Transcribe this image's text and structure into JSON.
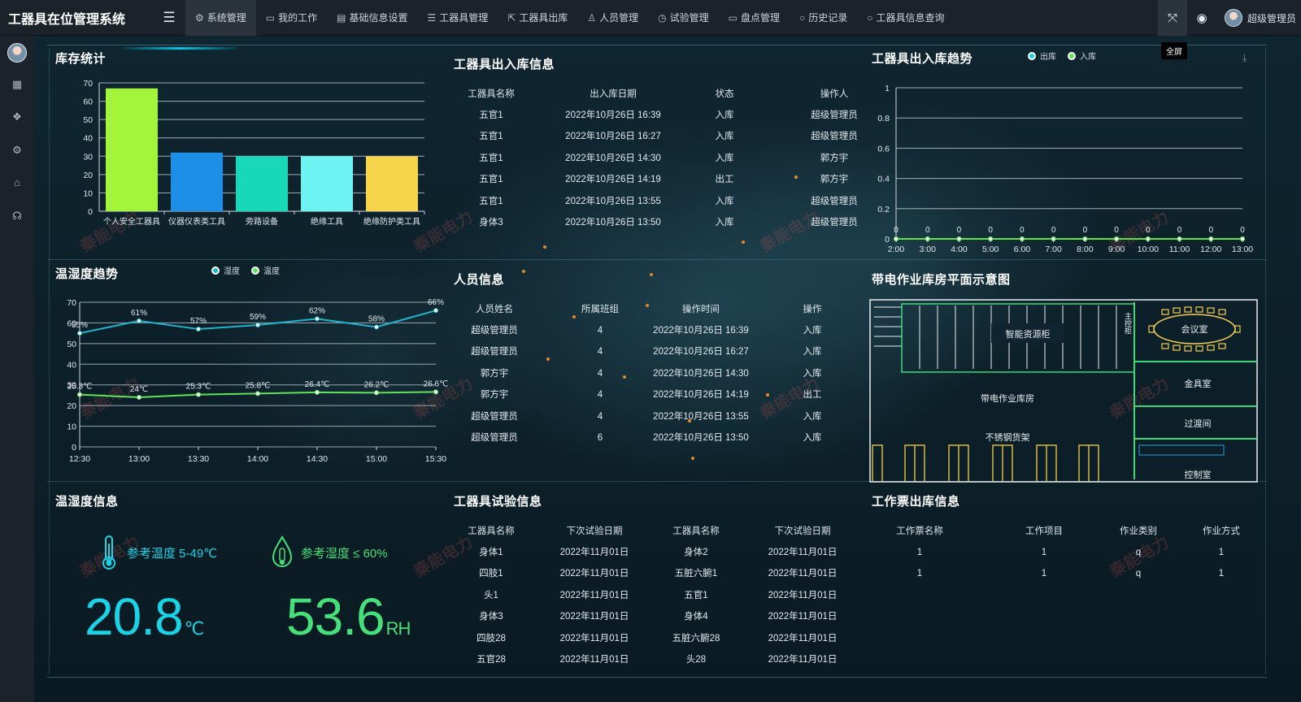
{
  "app_title": "工器具在位管理系统",
  "nav": [
    {
      "label": "系统管理",
      "icon": "gear-icon",
      "active": true
    },
    {
      "label": "我的工作",
      "icon": "monitor-icon"
    },
    {
      "label": "基础信息设置",
      "icon": "document-icon"
    },
    {
      "label": "工器具管理",
      "icon": "list-icon"
    },
    {
      "label": "工器具出库",
      "icon": "export-icon"
    },
    {
      "label": "人员管理",
      "icon": "users-icon"
    },
    {
      "label": "试验管理",
      "icon": "clock-icon"
    },
    {
      "label": "盘点管理",
      "icon": "monitor-icon"
    },
    {
      "label": "历史记录",
      "icon": "circle-icon"
    },
    {
      "label": "工器具信息查询",
      "icon": "circle-icon"
    }
  ],
  "topright": {
    "fullscreen_tooltip": "全屏",
    "user_name": "超级管理员"
  },
  "watermark_text": "秦能电力",
  "inventory": {
    "title": "库存统计"
  },
  "temp_trend": {
    "title": "温湿度趋势",
    "legend_humidity": "湿度",
    "legend_temp": "温度"
  },
  "io_info": {
    "title": "工器具出入库信息",
    "headers": [
      "工器具名称",
      "出入库日期",
      "状态",
      "操作人"
    ],
    "rows": [
      [
        "五官1",
        "2022年10月26日 16:39",
        "入库",
        "超级管理员"
      ],
      [
        "五官1",
        "2022年10月26日 16:27",
        "入库",
        "超级管理员"
      ],
      [
        "五官1",
        "2022年10月26日 14:30",
        "入库",
        "郭方宇"
      ],
      [
        "五官1",
        "2022年10月26日 14:19",
        "出工",
        "郭方宇"
      ],
      [
        "五官1",
        "2022年10月26日 13:55",
        "入库",
        "超级管理员"
      ],
      [
        "身体3",
        "2022年10月26日 13:50",
        "入库",
        "超级管理员"
      ]
    ]
  },
  "io_trend": {
    "title": "工器具出入库趋势",
    "legend_out": "出库",
    "legend_in": "入库"
  },
  "personnel": {
    "title": "人员信息",
    "headers": [
      "人员姓名",
      "所属班组",
      "操作时间",
      "操作"
    ],
    "rows": [
      [
        "超级管理员",
        "4",
        "2022年10月26日 16:39",
        "入库"
      ],
      [
        "超级管理员",
        "4",
        "2022年10月26日 16:27",
        "入库"
      ],
      [
        "郭方宇",
        "4",
        "2022年10月26日 14:30",
        "入库"
      ],
      [
        "郭方宇",
        "4",
        "2022年10月26日 14:19",
        "出工"
      ],
      [
        "超级管理员",
        "4",
        "2022年10月26日 13:55",
        "入库"
      ],
      [
        "超级管理员",
        "6",
        "2022年10月26日 13:50",
        "入库"
      ]
    ]
  },
  "floorplan": {
    "title": "带电作业库房平面示意图",
    "labels": {
      "cabinet": "智能资源柜",
      "master": "主控柜",
      "meeting": "会议室",
      "tools": "金具室",
      "warehouse": "带电作业库房",
      "transition": "过渡间",
      "shelf": "不锈钢货架",
      "control": "控制室"
    }
  },
  "th_info": {
    "title": "温湿度信息",
    "temp_ref": "参考温度 5-49℃",
    "hum_ref": "参考湿度 ≤ 60%",
    "temp_value": "20.8",
    "temp_unit": "℃",
    "hum_value": "53.6",
    "hum_unit": "RH",
    "colors": {
      "temp": "#19d3e6",
      "hum": "#45e07a"
    }
  },
  "test_info": {
    "title": "工器具试验信息",
    "headers": [
      "工器具名称",
      "下次试验日期",
      "工器具名称",
      "下次试验日期"
    ],
    "rows": [
      [
        "身体1",
        "2022年11月01日",
        "身体2",
        "2022年11月01日"
      ],
      [
        "四肢1",
        "2022年11月01日",
        "五脏六腑1",
        "2022年11月01日"
      ],
      [
        "头1",
        "2022年11月01日",
        "五官1",
        "2022年11月01日"
      ],
      [
        "身体3",
        "2022年11月01日",
        "身体4",
        "2022年11月01日"
      ],
      [
        "四肢28",
        "2022年11月01日",
        "五脏六腑28",
        "2022年11月01日"
      ],
      [
        "五官28",
        "2022年11月01日",
        "头28",
        "2022年11月01日"
      ]
    ]
  },
  "ticket_info": {
    "title": "工作票出库信息",
    "headers": [
      "工作票名称",
      "工作项目",
      "作业类别",
      "作业方式"
    ],
    "rows": [
      [
        "1",
        "1",
        "q",
        "1"
      ],
      [
        "1",
        "1",
        "q",
        "1"
      ]
    ]
  },
  "chart_data": [
    {
      "type": "bar",
      "categories": [
        "个人安全工器具",
        "仪器仪表类工具",
        "旁路设备",
        "绝缘工具",
        "绝缘防护类工具"
      ],
      "values": [
        67,
        32,
        30,
        30,
        30
      ],
      "colors": [
        "#a2f53b",
        "#1d8fe6",
        "#17d9b8",
        "#6ef3f3",
        "#f7d54a"
      ],
      "ylim": [
        0,
        70
      ],
      "yticks": [
        0,
        10,
        20,
        30,
        40,
        50,
        60,
        70
      ]
    },
    {
      "type": "line",
      "x": [
        "12:30",
        "13:00",
        "13:30",
        "14:00",
        "14:30",
        "15:00",
        "15:30"
      ],
      "ylim": [
        0,
        70
      ],
      "yticks": [
        0,
        10,
        20,
        30,
        40,
        50,
        60,
        70
      ],
      "series": [
        {
          "name": "湿度",
          "values": [
            55,
            61,
            57,
            59,
            62,
            58,
            66
          ],
          "labels": [
            "55%",
            "61%",
            "57%",
            "59%",
            "62%",
            "58%",
            "66%"
          ],
          "color": "#1fb5d0"
        },
        {
          "name": "温度",
          "values": [
            25.3,
            24,
            25.3,
            25.8,
            26.4,
            26.2,
            26.6
          ],
          "labels": [
            "25.3℃",
            "24℃",
            "25.3℃",
            "25.8℃",
            "26.4℃",
            "26.2℃",
            "26.6℃"
          ],
          "color": "#5fe35a"
        }
      ]
    },
    {
      "type": "line",
      "x": [
        "2:00",
        "3:00",
        "4:00",
        "5:00",
        "6:00",
        "7:00",
        "8:00",
        "9:00",
        "10:00",
        "11:00",
        "12:00",
        "13:00"
      ],
      "ylim": [
        0,
        1
      ],
      "yticks": [
        0,
        0.2,
        0.4,
        0.6,
        0.8,
        1
      ],
      "series": [
        {
          "name": "出库",
          "values": [
            0,
            0,
            0,
            0,
            0,
            0,
            0,
            0,
            0,
            0,
            0,
            0
          ],
          "color": "#18d2e3"
        },
        {
          "name": "入库",
          "values": [
            0,
            0,
            0,
            0,
            0,
            0,
            0,
            0,
            0,
            0,
            0,
            0
          ],
          "color": "#62e34a"
        }
      ]
    }
  ]
}
